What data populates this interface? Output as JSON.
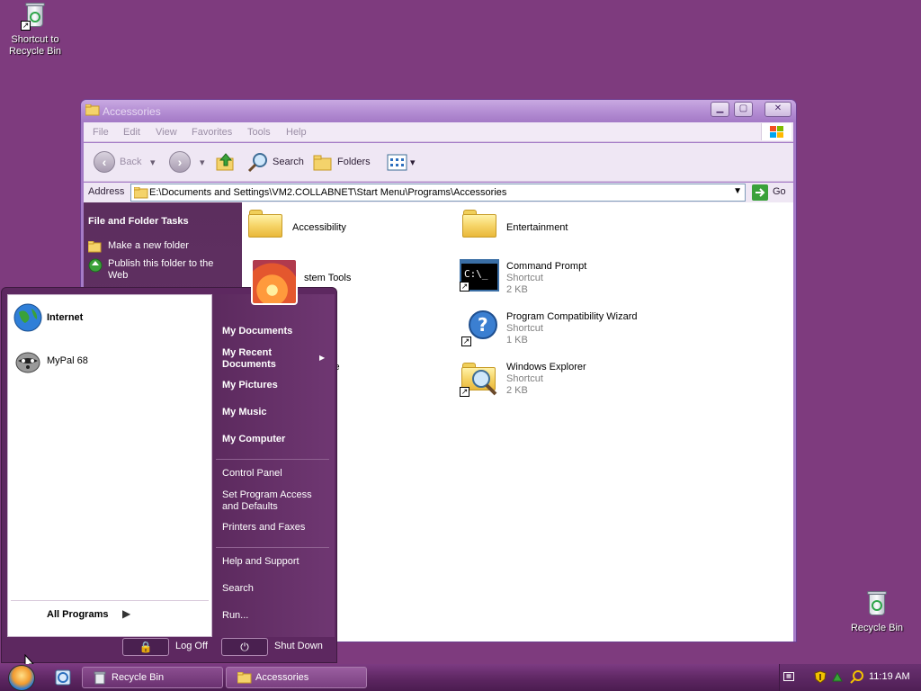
{
  "desktop": {
    "icons": [
      {
        "label_line1": "Shortcut to",
        "label_line2": "Recycle Bin"
      },
      {
        "label_line1": "Recycle Bin",
        "label_line2": ""
      }
    ]
  },
  "window": {
    "title": "Accessories",
    "menu": [
      "File",
      "Edit",
      "View",
      "Favorites",
      "Tools",
      "Help"
    ],
    "toolbar": {
      "back": "Back",
      "search": "Search",
      "folders": "Folders"
    },
    "address": {
      "label": "Address",
      "value": "E:\\Documents and Settings\\VM2.COLLABNET\\Start Menu\\Programs\\Accessories",
      "go": "Go"
    },
    "taskpane": {
      "title": "File and Folder Tasks",
      "links": [
        "Make a new folder",
        "Publish this folder to the Web"
      ]
    },
    "items": [
      {
        "name": "Accessibility",
        "type": "",
        "size": ""
      },
      {
        "name": "Entertainment",
        "type": "",
        "size": ""
      },
      {
        "name": "stem Tools",
        "type": "",
        "size": ""
      },
      {
        "name": "Command Prompt",
        "type": "Shortcut",
        "size": "2 KB"
      },
      {
        "name": "Program Compatibility Wizard",
        "type": "Shortcut",
        "size": "1 KB"
      },
      {
        "name": "ze",
        "type": "",
        "size": ""
      },
      {
        "name": "Windows Explorer",
        "type": "Shortcut",
        "size": "2 KB"
      }
    ]
  },
  "startmenu": {
    "pinned": [
      {
        "label": "Internet"
      },
      {
        "label": "MyPal 68"
      }
    ],
    "all_programs": "All Programs",
    "right": [
      "My Documents",
      "My Recent Documents",
      "My Pictures",
      "My Music",
      "My Computer",
      "Control Panel",
      "Set Program Access and Defaults",
      "Printers and Faxes",
      "Help and Support",
      "Search",
      "Run..."
    ],
    "log_off": "Log Off",
    "shut_down": "Shut Down"
  },
  "taskbar": {
    "buttons": [
      "Recycle Bin",
      "Accessories"
    ],
    "clock": "11:19 AM"
  }
}
